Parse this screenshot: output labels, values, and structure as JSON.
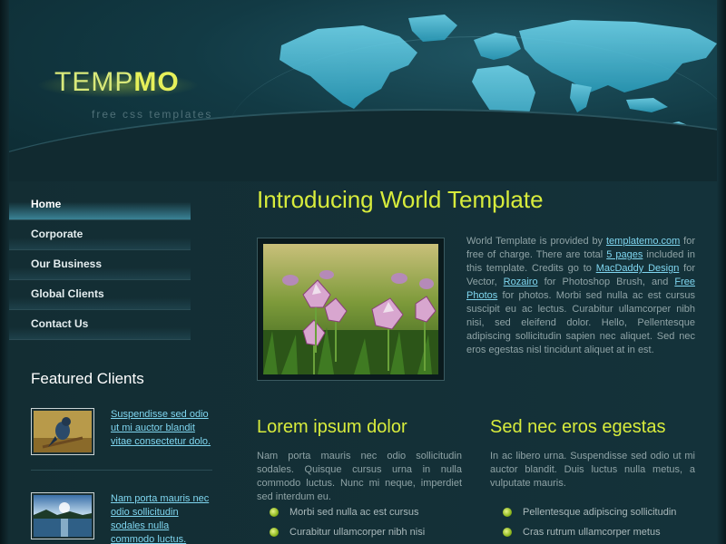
{
  "brand": {
    "logo_part1": "TEMP",
    "logo_part2": "MO",
    "tagline": "free css templates",
    "accent_color": "#d8ec3c",
    "link_color": "#7fd6f0"
  },
  "nav": {
    "items": [
      {
        "label": "Home",
        "active": true
      },
      {
        "label": "Corporate",
        "active": false
      },
      {
        "label": "Our Business",
        "active": false
      },
      {
        "label": "Global Clients",
        "active": false
      },
      {
        "label": "Contact Us",
        "active": false
      }
    ]
  },
  "featured": {
    "title": "Featured Clients",
    "clients": [
      {
        "text": "Suspendisse sed odio ut mi auctor blandit vitae consectetur dolo.",
        "thumb": "bird-photo"
      },
      {
        "text": "Nam porta mauris nec odio sollicitudin sodales nulla commodo luctus.",
        "thumb": "lake-photo"
      }
    ]
  },
  "main": {
    "title": "Introducing World Template",
    "photo": "flowers-photo",
    "intro": {
      "t1": "World Template is provided by ",
      "link1": "templatemo.com",
      "t2": " for free of charge. There are total ",
      "link2": "5 pages",
      "t3": " included in this template. Credits go to ",
      "link3": "MacDaddy Design",
      "t4": " for Vector, ",
      "link4": "Rozairo",
      "t5": " for Photoshop Brush, and ",
      "link5": "Free Photos",
      "t6": " for photos. Morbi sed nulla ac est cursus suscipit eu ac lectus. Curabitur ullamcorper nibh nisi, sed eleifend dolor. Hello, Pellentesque adipiscing sollicitudin sapien nec aliquet. Sed nec eros egestas nisl tincidunt aliquet at in est."
    },
    "columns": [
      {
        "title": "Lorem ipsum dolor",
        "text": "Nam porta mauris nec odio sollicitudin sodales. Quisque cursus urna in nulla commodo luctus. Nunc mi neque, imperdiet sed interdum eu.",
        "items": [
          "Morbi sed nulla ac est cursus",
          "Curabitur ullamcorper nibh nisi"
        ]
      },
      {
        "title": "Sed nec eros egestas",
        "text": "In ac libero urna. Suspendisse sed odio ut mi auctor blandit. Duis luctus nulla metus, a vulputate mauris.",
        "items": [
          "Pellentesque adipiscing sollicitudin",
          "Cras rutrum ullamcorper metus"
        ]
      }
    ]
  }
}
